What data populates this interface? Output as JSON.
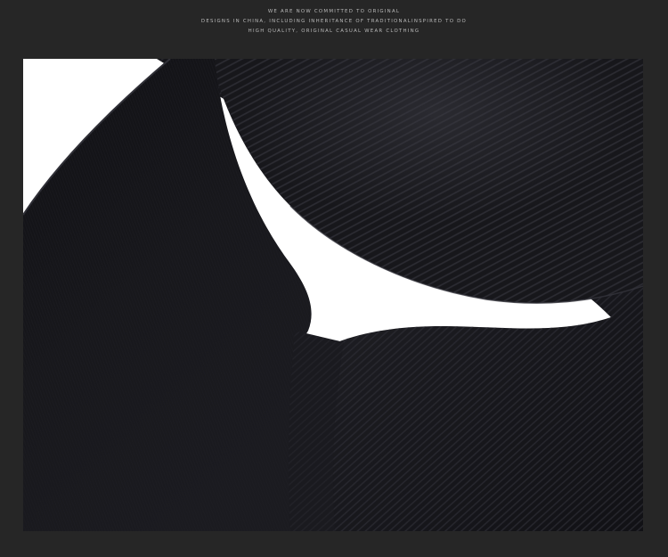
{
  "header": {
    "lines": [
      "WE ARE NOW COMMITTED TO ORIGINAL",
      "DESIGNS IN CHINA, INCLUDING INHERITANCE OF TRADITIONALINSPIRED TO DO",
      "HIGH QUALITY, ORIGINAL CASUAL WEAR CLOTHING"
    ]
  },
  "colors": {
    "page_background": "#262626",
    "photo_backdrop": "#ffffff",
    "fabric": "#141417",
    "tagline_text": "#b9b9b9"
  },
  "photo": {
    "subject": "black-ribbed-knit-fabric"
  }
}
